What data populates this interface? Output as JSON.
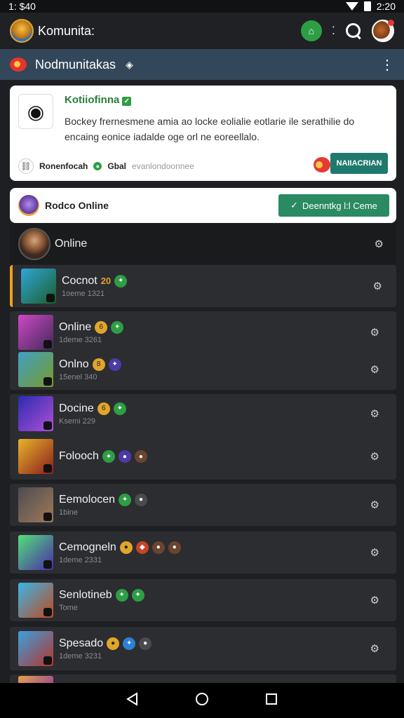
{
  "status": {
    "time": "1: $40",
    "battery": "2:20"
  },
  "appbar": {
    "title": "Komunita:"
  },
  "subbar": {
    "title": "Nodmunitakas"
  },
  "info_card": {
    "title": "Kotiiofinna",
    "description": "Bockey frernesmene amia ao locke eolialie eotlarie ile serathilie do encaing eonice iadalde oge orl ne eoreellalo.",
    "foot_name": "Ronenfocah",
    "foot_label": "Gbal",
    "foot_sub": "evanlondoonnee",
    "button_label": "NAIIACRIAN"
  },
  "online_card": {
    "title": "Rodco Online",
    "button_label": "Deenntkg l:l Ceme"
  },
  "online_header": {
    "label": "Online"
  },
  "members": [
    {
      "name": "Cocnot",
      "tag": "20",
      "tag_color": "#e0a52b",
      "sub": "1oeme 1321"
    },
    {
      "name": "Online",
      "tag": "6",
      "tag_color": "#e0a52b",
      "sub": "1deme 3261"
    },
    {
      "name": "Onlno",
      "tag": "8",
      "tag_color": "#e0a52b",
      "sub": "15enel 340"
    },
    {
      "name": "Docine",
      "tag": "6",
      "tag_color": "#e0a52b",
      "sub": "Ksemi 229"
    },
    {
      "name": "Folooch",
      "tag": "",
      "tag_color": "",
      "sub": ""
    },
    {
      "name": "Eemolocen",
      "tag": "",
      "tag_color": "",
      "sub": "1bine"
    },
    {
      "name": "Cemogneln",
      "tag": "",
      "tag_color": "",
      "sub": "1deme 2331"
    },
    {
      "name": "Senlotineb",
      "tag": "",
      "tag_color": "",
      "sub": "Tome"
    },
    {
      "name": "Spesado",
      "tag": "",
      "tag_color": "",
      "sub": "1deme 3231"
    }
  ],
  "icons": {
    "status_wifi": "wifi-icon",
    "status_battery": "battery-icon",
    "app_logo": "app-logo-icon",
    "green_action": "home-icon",
    "search": "search-icon",
    "gear": "gear-icon",
    "back": "back-icon",
    "home": "home-nav-icon",
    "recents": "recents-icon"
  }
}
